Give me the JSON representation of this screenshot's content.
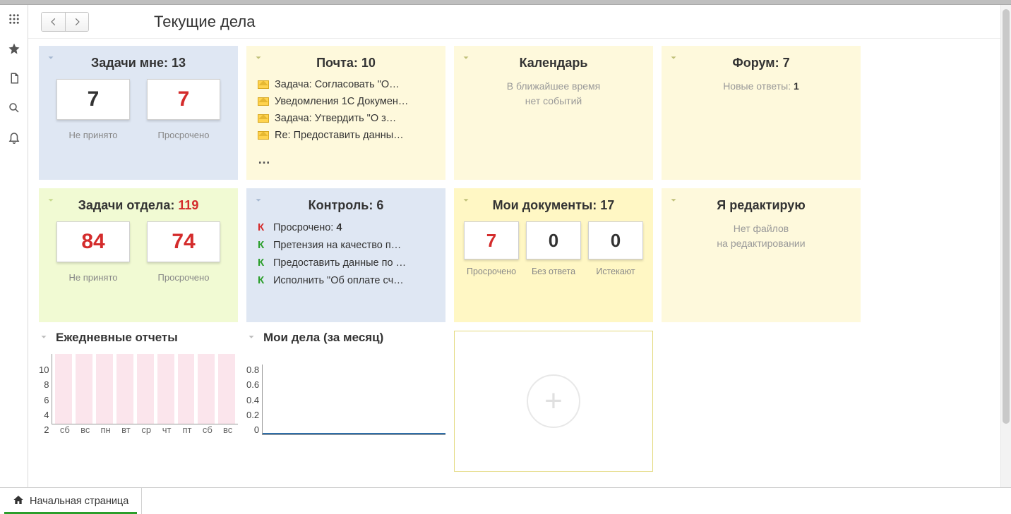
{
  "page_title": "Текущие дела",
  "footer_tab": "Начальная страница",
  "widgets": {
    "tasks_me": {
      "title_prefix": "Задачи мне: ",
      "count": "13",
      "tiles": [
        {
          "val": "7",
          "red": false,
          "label": "Не принято"
        },
        {
          "val": "7",
          "red": true,
          "label": "Просрочено"
        }
      ]
    },
    "mail": {
      "title_prefix": "Почта: ",
      "count": "10",
      "items": [
        "Задача: Согласовать \"О…",
        "Уведомления 1С Докумен…",
        "Задача: Утвердить \"О з…",
        "Re: Предоставить данны…"
      ],
      "more": "…"
    },
    "calendar": {
      "title": "Календарь",
      "note_l1": "В ближайшее время",
      "note_l2": "нет событий"
    },
    "forum": {
      "title_prefix": "Форум: ",
      "count": "7",
      "answers_label": "Новые ответы: ",
      "answers_count": "1"
    },
    "tasks_dept": {
      "title_prefix": "Задачи отдела: ",
      "count": "119",
      "tiles": [
        {
          "val": "84",
          "red": true,
          "label": "Не принято"
        },
        {
          "val": "74",
          "red": true,
          "label": "Просрочено"
        }
      ]
    },
    "control": {
      "title_prefix": "Контроль: ",
      "count": "6",
      "items": [
        {
          "k": "red",
          "text": "Просрочено: ",
          "bold": "4"
        },
        {
          "k": "green",
          "text": "Претензия на качество п…"
        },
        {
          "k": "green",
          "text": "Предоставить данные по …"
        },
        {
          "k": "green",
          "text": "Исполнить \"Об оплате сч…"
        }
      ]
    },
    "my_docs": {
      "title_prefix": "Мои документы: ",
      "count": "17",
      "tiles": [
        {
          "val": "7",
          "red": true,
          "label": "Просрочено"
        },
        {
          "val": "0",
          "red": false,
          "label": "Без ответа"
        },
        {
          "val": "0",
          "red": false,
          "label": "Истекают"
        }
      ]
    },
    "editing": {
      "title": "Я редактирую",
      "note_l1": "Нет файлов",
      "note_l2": "на редактировании"
    },
    "daily_reports": {
      "title": "Ежедневные отчеты"
    },
    "my_deals": {
      "title": "Мои дела (за месяц)"
    }
  },
  "chart_data": [
    {
      "id": "daily_reports",
      "type": "bar",
      "title": "Ежедневные отчеты",
      "categories": [
        "сб",
        "вс",
        "пн",
        "вт",
        "ср",
        "чт",
        "пт",
        "сб",
        "вс"
      ],
      "values": [
        10,
        10,
        10,
        10,
        10,
        10,
        10,
        10,
        10
      ],
      "ylim": [
        0,
        10
      ],
      "yticks": [
        10,
        8,
        6,
        4,
        2
      ],
      "xlabel": "",
      "ylabel": ""
    },
    {
      "id": "my_deals",
      "type": "line",
      "title": "Мои дела (за месяц)",
      "x": [
        0,
        1
      ],
      "values": [
        0,
        0
      ],
      "ylim": [
        0,
        0.8
      ],
      "yticks": [
        0.8,
        0.6,
        0.4,
        0.2,
        0
      ],
      "xlabel": "",
      "ylabel": ""
    }
  ]
}
